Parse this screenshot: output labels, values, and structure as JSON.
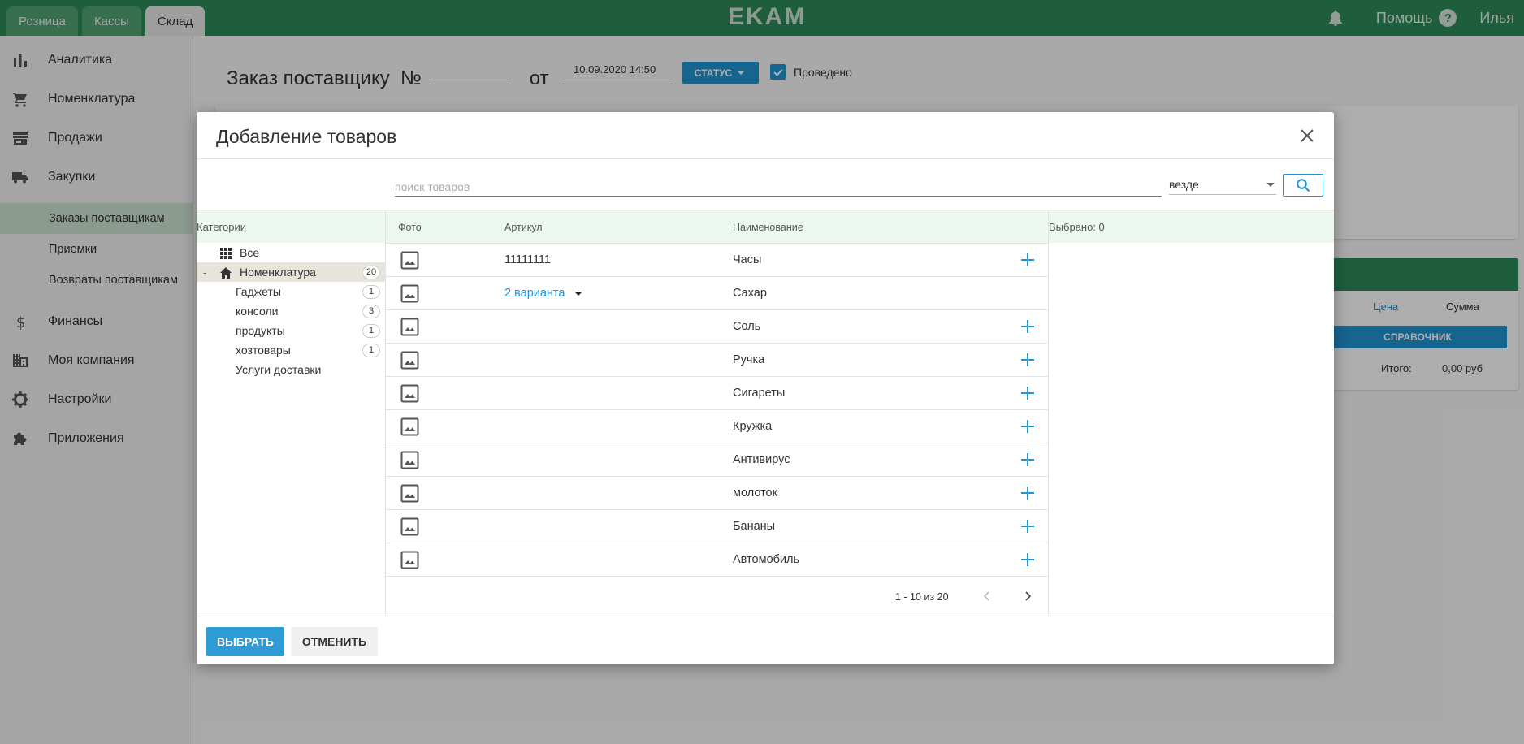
{
  "topbar": {
    "tabs": [
      {
        "label": "Розница"
      },
      {
        "label": "Кассы"
      },
      {
        "label": "Склад"
      }
    ],
    "brand": "EKAM",
    "help_label": "Помощь",
    "help_glyph": "?",
    "user_name": "Илья"
  },
  "sidebar": {
    "items": [
      {
        "label": "Аналитика",
        "icon": "bar-chart-icon"
      },
      {
        "label": "Номенклатура",
        "icon": "cart-icon"
      },
      {
        "label": "Продажи",
        "icon": "store-icon"
      },
      {
        "label": "Закупки",
        "icon": "truck-icon"
      }
    ],
    "sub_items": [
      {
        "label": "Заказы поставщикам"
      },
      {
        "label": "Приемки"
      },
      {
        "label": "Возвраты поставщикам"
      }
    ],
    "items_after": [
      {
        "label": "Финансы",
        "icon": "dollar-icon"
      },
      {
        "label": "Моя компания",
        "icon": "building-icon"
      },
      {
        "label": "Настройки",
        "icon": "gear-icon"
      },
      {
        "label": "Приложения",
        "icon": "puzzle-icon"
      }
    ]
  },
  "page": {
    "title": "Заказ поставщику  №",
    "ot": "от",
    "date": "10.09.2020 14:50",
    "status_label": "СТАТУС",
    "posted_label": "Проведено",
    "price_col": "Цена",
    "sum_col": "Сумма",
    "reference_label": "СПРАВОЧНИК",
    "total_label": "Итого:",
    "total_value": "0,00 руб"
  },
  "modal": {
    "title": "Добавление товаров",
    "search_placeholder": "поиск товаров",
    "scope_value": "везде",
    "categories_header": "Категории",
    "categories": [
      {
        "label": "Все",
        "icon": "grid-icon"
      },
      {
        "label": "Номенклатура",
        "icon": "home-icon",
        "count": "20",
        "minus": "-"
      },
      {
        "label": "Гаджеты",
        "count": "1"
      },
      {
        "label": "консоли",
        "count": "3"
      },
      {
        "label": "продукты",
        "count": "1"
      },
      {
        "label": "хозтовары",
        "count": "1"
      },
      {
        "label": "Услуги доставки"
      }
    ],
    "columns": {
      "photo": "Фото",
      "article": "Артикул",
      "name": "Наименование"
    },
    "products": [
      {
        "article": "11111111",
        "name": "Часы"
      },
      {
        "article": "2 варианта",
        "name": "Сахар"
      },
      {
        "article": "",
        "name": "Соль"
      },
      {
        "article": "",
        "name": "Ручка"
      },
      {
        "article": "",
        "name": "Сигареты"
      },
      {
        "article": "",
        "name": "Кружка"
      },
      {
        "article": "",
        "name": "Антивирус"
      },
      {
        "article": "",
        "name": "молоток"
      },
      {
        "article": "",
        "name": "Бананы"
      },
      {
        "article": "",
        "name": "Автомобиль"
      }
    ],
    "pagination": "1 - 10 из 20",
    "selected_label": "Выбрано: 0",
    "select_button": "ВЫБРАТЬ",
    "cancel_button": "ОТМЕНИТЬ"
  },
  "colors": {
    "brand_green": "#2e8b5a",
    "accent_blue": "#2196d3"
  }
}
